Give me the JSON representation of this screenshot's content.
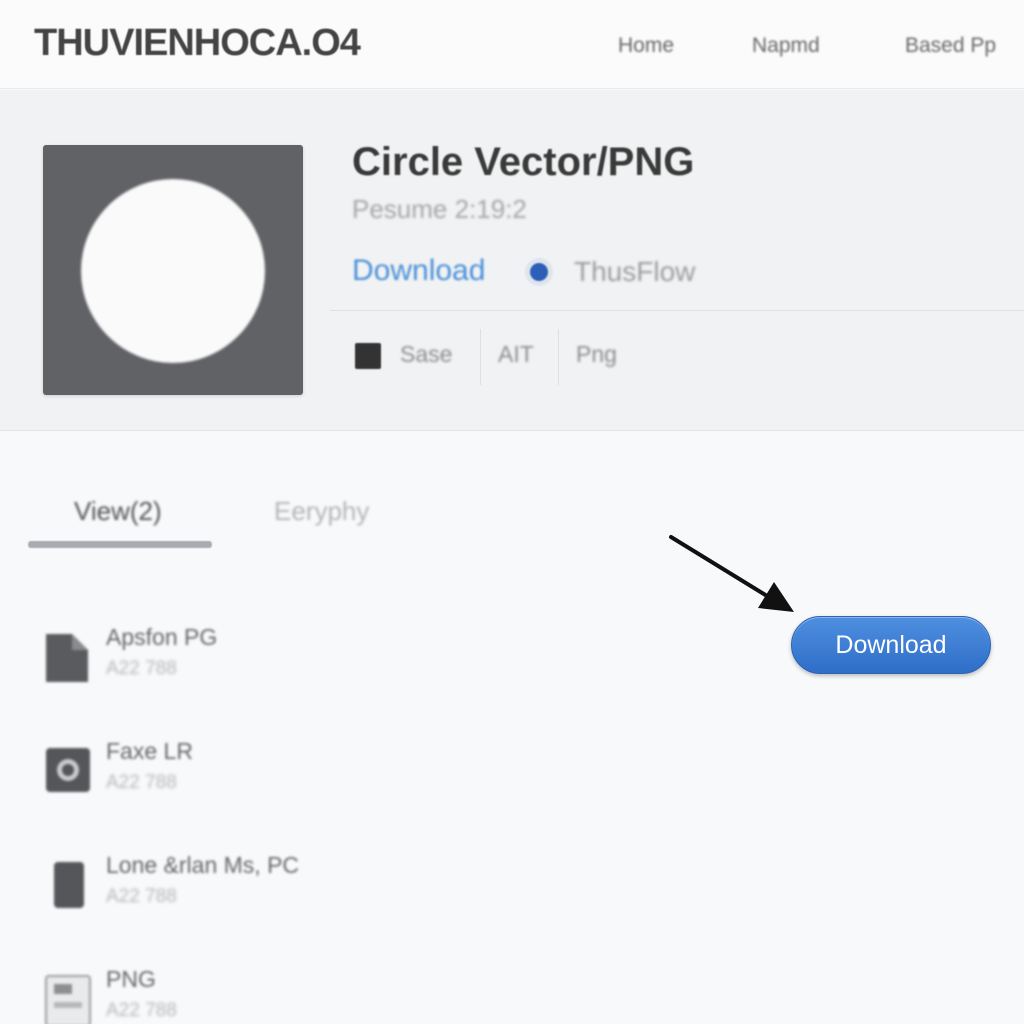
{
  "site": {
    "logo": "THUVIENHOCA.O4",
    "nav": [
      "Home",
      "Napmd",
      "Based Pp"
    ]
  },
  "product": {
    "title": "Circle Vector/PNG",
    "subtitle": "Pesume 2:19:2",
    "download_link": "Download",
    "author": "ThusFlow",
    "meta": [
      "Sase",
      "AIT",
      "Png"
    ]
  },
  "tabs": [
    "View(2)",
    "Eeryphy"
  ],
  "action": {
    "download_label": "Download"
  },
  "files": [
    {
      "name": "Apsfon PG",
      "size": "A22 788"
    },
    {
      "name": "Faxe LR",
      "size": "A22 788"
    },
    {
      "name": "Lone &rlan Ms, PC",
      "size": "A22 788"
    },
    {
      "name": "PNG",
      "size": "A22 788"
    }
  ],
  "colors": {
    "accent": "#3478d4",
    "thumb_bg": "#616266",
    "author_dot": "#2e5fb8"
  }
}
